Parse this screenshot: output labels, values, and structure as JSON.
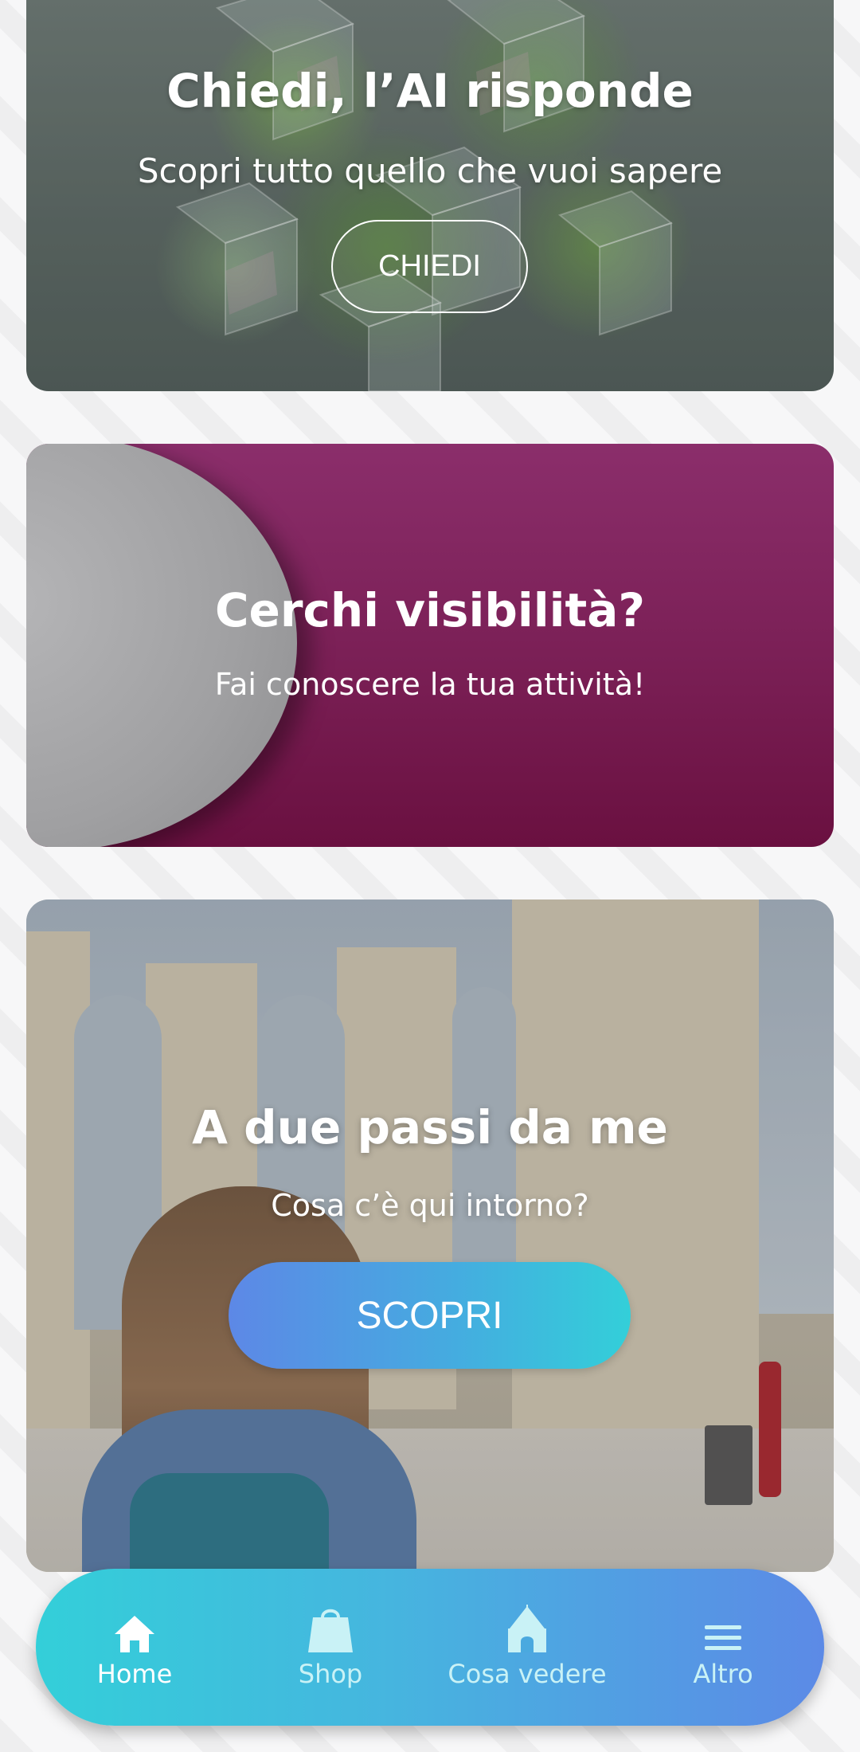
{
  "cards": {
    "ai": {
      "title": "Chiedi, l’AI risponde",
      "subtitle": "Scopri tutto quello che vuoi sapere",
      "button_label": "CHIEDI"
    },
    "visibility": {
      "title": "Cerchi visibilità?",
      "subtitle": "Fai conoscere la tua attività!"
    },
    "nearby": {
      "title": "A due passi da me",
      "subtitle": "Cosa c’è qui intorno?",
      "button_label": "SCOPRI"
    }
  },
  "bottom_nav": {
    "items": [
      {
        "label": "Home",
        "icon": "home-icon",
        "active": true
      },
      {
        "label": "Shop",
        "icon": "shopping-bag-icon",
        "active": false
      },
      {
        "label": "Cosa vedere",
        "icon": "trullo-icon",
        "active": false
      },
      {
        "label": "Altro",
        "icon": "menu-icon",
        "active": false
      }
    ]
  },
  "colors": {
    "accent_start": "#5d88e6",
    "accent_end": "#33cfd9",
    "visibility_card": "#7a1f55"
  }
}
